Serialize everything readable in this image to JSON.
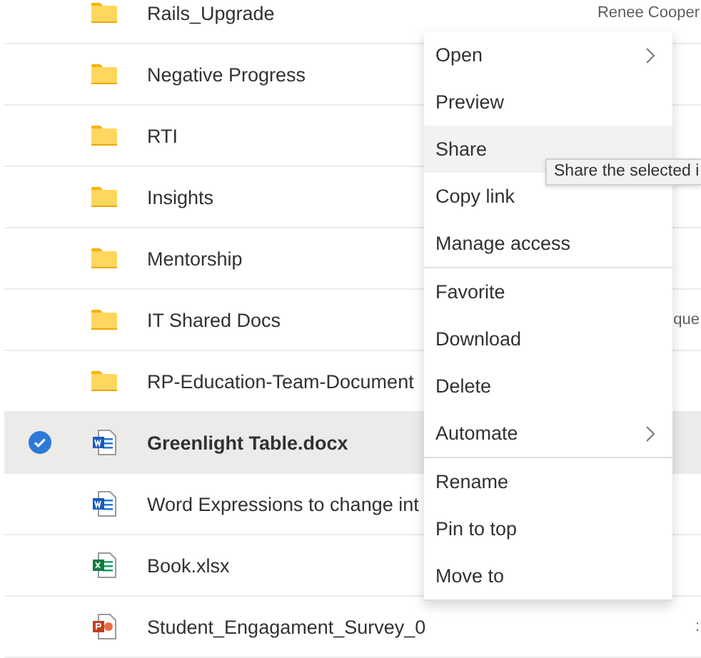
{
  "files": [
    {
      "name": "Rails_Upgrade",
      "kind": "folder",
      "selected": false,
      "column_3": "Renee Cooper"
    },
    {
      "name": "Negative Progress",
      "kind": "folder",
      "selected": false
    },
    {
      "name": "RTI",
      "kind": "folder",
      "selected": false
    },
    {
      "name": "Insights",
      "kind": "folder",
      "selected": false
    },
    {
      "name": "Mentorship",
      "kind": "folder",
      "selected": false
    },
    {
      "name": "IT Shared Docs",
      "kind": "folder",
      "selected": false,
      "column_3": "que"
    },
    {
      "name": "RP-Education-Team-Document",
      "kind": "folder",
      "selected": false
    },
    {
      "name": "Greenlight Table.docx",
      "kind": "word",
      "selected": true
    },
    {
      "name": "Word Expressions to change int",
      "kind": "word",
      "selected": false
    },
    {
      "name": "Book.xlsx",
      "kind": "excel",
      "selected": false
    },
    {
      "name": "Student_Engagament_Survey_0",
      "kind": "powerpoint",
      "selected": false,
      "column_3": ":"
    }
  ],
  "context_menu": {
    "groups": [
      [
        {
          "label": "Open",
          "submenu": true,
          "hovered": false
        },
        {
          "label": "Preview",
          "submenu": false,
          "hovered": false
        },
        {
          "label": "Share",
          "submenu": false,
          "hovered": true
        },
        {
          "label": "Copy link",
          "submenu": false,
          "hovered": false
        },
        {
          "label": "Manage access",
          "submenu": false,
          "hovered": false
        }
      ],
      [
        {
          "label": "Favorite",
          "submenu": false,
          "hovered": false
        },
        {
          "label": "Download",
          "submenu": false,
          "hovered": false
        },
        {
          "label": "Delete",
          "submenu": false,
          "hovered": false
        },
        {
          "label": "Automate",
          "submenu": true,
          "hovered": false
        }
      ],
      [
        {
          "label": "Rename",
          "submenu": false,
          "hovered": false
        },
        {
          "label": "Pin to top",
          "submenu": false,
          "hovered": false
        },
        {
          "label": "Move to",
          "submenu": false,
          "hovered": false
        }
      ]
    ]
  },
  "tooltip": {
    "text": "Share the selected i"
  }
}
